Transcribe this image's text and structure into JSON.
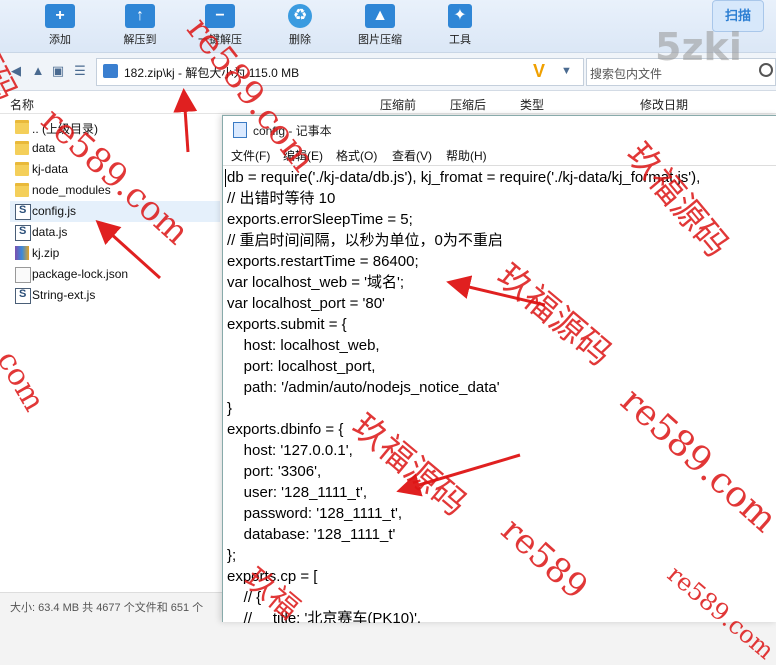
{
  "toolbar": {
    "buttons": [
      "添加",
      "解压到",
      "一键解压",
      "删除",
      "图片压缩",
      "工具"
    ],
    "scan_label": "扫描"
  },
  "address": {
    "path": "182.zip\\kj - 解包大小为 115.0 MB",
    "search_placeholder": "搜索包内文件"
  },
  "columns": [
    "名称",
    "压缩前",
    "压缩后",
    "类型",
    "修改日期"
  ],
  "files": [
    {
      "name": ".. (上级目录)",
      "icon": "folder-icon"
    },
    {
      "name": "data",
      "icon": "folder-icon"
    },
    {
      "name": "kj-data",
      "icon": "folder-icon"
    },
    {
      "name": "node_modules",
      "icon": "folder-icon"
    },
    {
      "name": "config.js",
      "icon": "js-file-icon"
    },
    {
      "name": "data.js",
      "icon": "js-file-icon"
    },
    {
      "name": "kj.zip",
      "icon": "zip-file-icon"
    },
    {
      "name": "package-lock.json",
      "icon": "json-file-icon"
    },
    {
      "name": "String-ext.js",
      "icon": "js-file-icon"
    }
  ],
  "status": "大小: 63.4 MB 共 4677 个文件和 651 个",
  "notepad": {
    "title": "config - 记事本",
    "menu": [
      "文件(F)",
      "编辑(E)",
      "格式(O)",
      "查看(V)",
      "帮助(H)"
    ],
    "lines": [
      "db = require('./kj-data/db.js'), kj_fromat = require('./kj-data/kj_format.js'),",
      "// 出错时等待 10",
      "exports.errorSleepTime = 5;",
      "// 重启时间间隔，以秒为单位，0为不重启",
      "exports.restartTime = 86400;",
      "var localhost_web = '域名';",
      "var localhost_port = '80'",
      "exports.submit = {",
      "    host: localhost_web,",
      "    port: localhost_port,",
      "    path: '/admin/auto/nodejs_notice_data'",
      "}",
      "exports.dbinfo = {",
      "    host: '127.0.0.1',",
      "    port: '3306',",
      "    user: '128_1111_t',",
      "    password: '128_1111_t',",
      "    database: '128_1111_t'",
      "};",
      "exports.cp = [",
      "    // {",
      "    //     title: '北京赛车(PK10)',"
    ]
  },
  "watermarks": {
    "brand": "5zki",
    "texts": [
      "re589.com",
      "玖福源码",
      "玖福源码",
      "re589.com",
      "玖福源码",
      "re589.com",
      "re589",
      "com",
      "re589.com",
      "源码",
      "玖福"
    ]
  },
  "colors": {
    "annotation": "#e02020",
    "toolbar_icon": "#2f86d6",
    "selection": "#e5f0fb"
  }
}
